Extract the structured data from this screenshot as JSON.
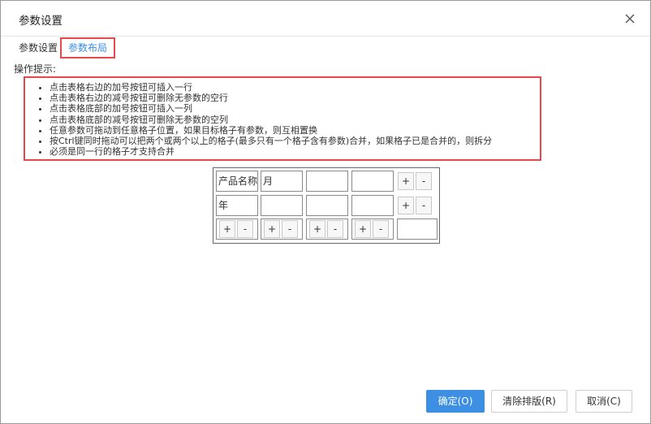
{
  "dialog": {
    "title": "参数设置"
  },
  "tabs": [
    {
      "label": "参数设置"
    },
    {
      "label": "参数布局"
    }
  ],
  "hints": {
    "label": "操作提示:",
    "items": [
      "点击表格右边的加号按钮可插入一行",
      "点击表格右边的减号按钮可删除无参数的空行",
      "点击表格底部的加号按钮可插入一列",
      "点击表格底部的减号按钮可删除无参数的空列",
      "任意参数可拖动到任意格子位置，如果目标格子有参数，则互相置换",
      "按Ctrl键同时拖动可以把两个或两个以上的格子(最多只有一个格子含有参数)合并，如果格子已是合并的，则拆分",
      "必须是同一行的格子才支持合并"
    ]
  },
  "grid": {
    "rows": [
      [
        "产品名称",
        "月",
        "",
        ""
      ],
      [
        "年",
        "",
        "",
        ""
      ]
    ],
    "plus": "+",
    "minus": "-"
  },
  "footer": {
    "ok": "确定(O)",
    "clear": "清除排版(R)",
    "cancel": "取消(C)"
  },
  "colors": {
    "accent": "#3d8fe3",
    "highlight": "#e8474f"
  }
}
